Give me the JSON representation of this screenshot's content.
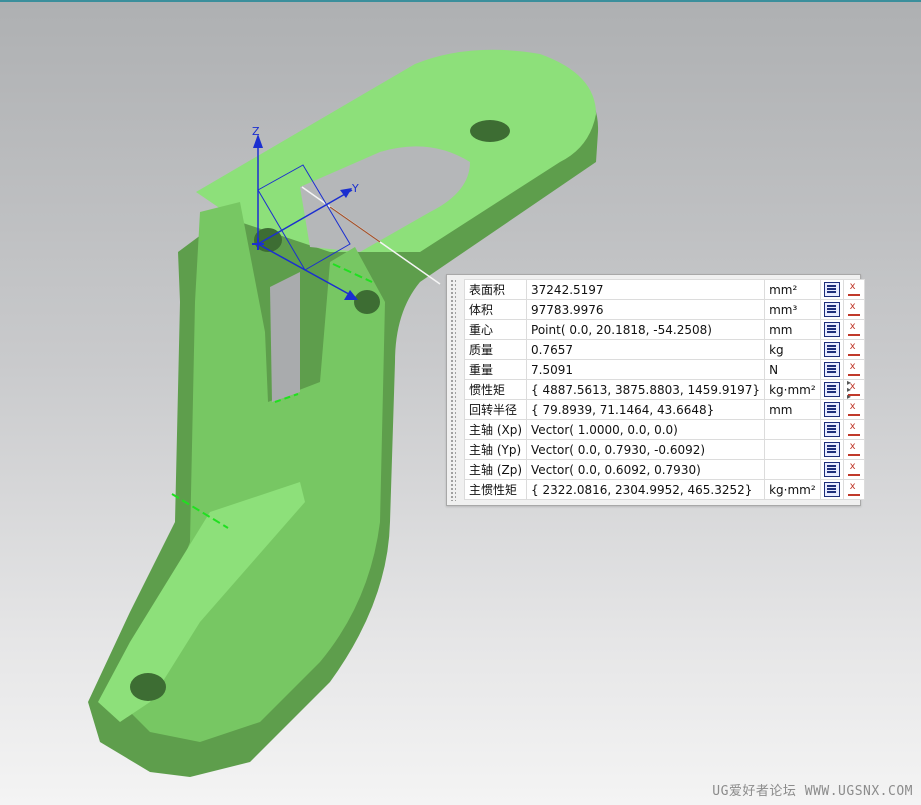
{
  "viewport": {
    "background_top": "#aeb0b2",
    "background_bottom": "#f4f4f4",
    "model_color": "#8de07a",
    "csys_color": "#1b2fd0",
    "axis_labels": {
      "z": "Z",
      "y": "Y"
    },
    "watermark": "UG爱好者论坛 WWW.UGSNX.COM"
  },
  "properties_panel": {
    "rows": [
      {
        "name": "表面积",
        "value": "37242.5197",
        "unit": "mm²"
      },
      {
        "name": "体积",
        "value": "97783.9976",
        "unit": "mm³"
      },
      {
        "name": "重心",
        "value": "Point( 0.0, 20.1818, -54.2508)",
        "unit": "mm"
      },
      {
        "name": "质量",
        "value": "0.7657",
        "unit": "kg"
      },
      {
        "name": "重量",
        "value": "7.5091",
        "unit": "N"
      },
      {
        "name": "惯性矩",
        "value": "{ 4887.5613, 3875.8803, 1459.9197}",
        "unit": "kg·mm²"
      },
      {
        "name": "回转半径",
        "value": "{ 79.8939, 71.1464, 43.6648}",
        "unit": "mm"
      },
      {
        "name": "主轴 (Xp)",
        "value": "Vector( 1.0000, 0.0, 0.0)",
        "unit": ""
      },
      {
        "name": "主轴 (Yp)",
        "value": "Vector( 0.0, 0.7930, -0.6092)",
        "unit": ""
      },
      {
        "name": "主轴 (Zp)",
        "value": "Vector( 0.0, 0.6092, 0.7930)",
        "unit": ""
      },
      {
        "name": "主惯性矩",
        "value": "{ 2322.0816, 2304.9952, 465.3252}",
        "unit": "kg·mm²"
      }
    ],
    "row_icons": [
      "export-to-info-icon",
      "export-to-expression-icon"
    ]
  }
}
